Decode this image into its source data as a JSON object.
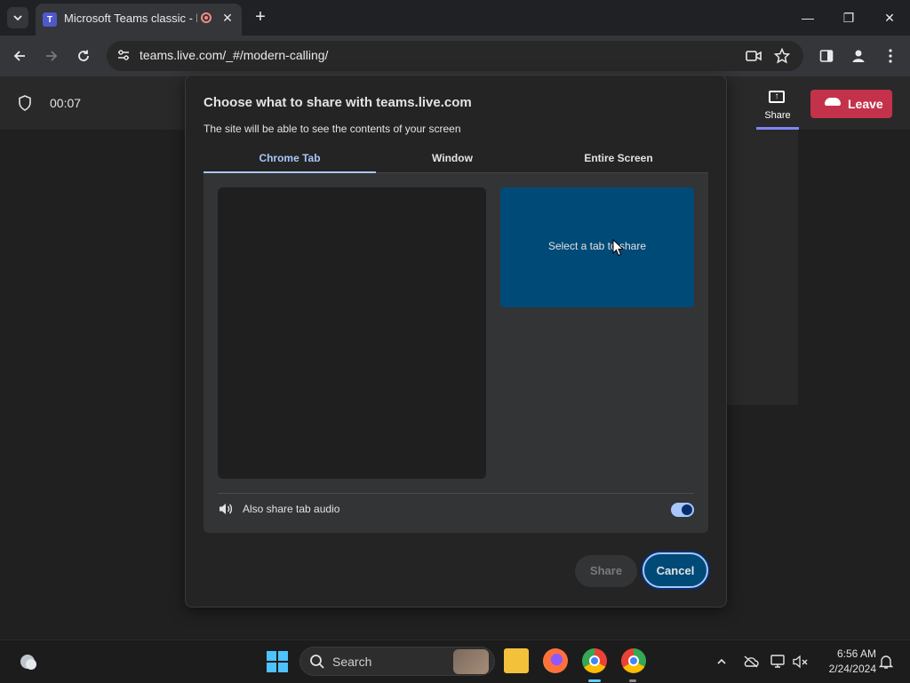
{
  "browser": {
    "tab_title": "Microsoft Teams classic - lo",
    "tab_favicon": "T",
    "new_tab_symbol": "+",
    "close_symbol": "✕",
    "url": "teams.live.com/_#/modern-calling/",
    "window_controls": {
      "minimize": "—",
      "restore": "❐",
      "close": "✕"
    },
    "icons": [
      "tab-search-icon",
      "record-icon",
      "back-icon",
      "forward-icon",
      "reload-icon",
      "site-info-icon",
      "camera-icon",
      "bookmark-star-icon",
      "side-panel-icon",
      "profile-icon",
      "more-icon"
    ]
  },
  "teams": {
    "timer": "00:07",
    "share_label": "Share",
    "leave_label": "Leave"
  },
  "dialog": {
    "title": "Choose what to share with teams.live.com",
    "subtitle": "The site will be able to see the contents of your screen",
    "tabs": [
      {
        "label": "Chrome Tab",
        "selected": true
      },
      {
        "label": "Window",
        "selected": false
      },
      {
        "label": "Entire Screen",
        "selected": false
      }
    ],
    "tab_card_label": "Select a tab to share",
    "audio_label": "Also share tab audio",
    "audio_enabled": true,
    "share_button": "Share",
    "cancel_button": "Cancel"
  },
  "taskbar": {
    "search_label": "Search",
    "time": "6:56 AM",
    "date": "2/24/2024",
    "apps": [
      "file-explorer-icon",
      "firefox-icon",
      "chrome-icon",
      "chrome-canary-icon"
    ]
  },
  "colors": {
    "accent_blue": "#a8c7fa",
    "tab_card": "#004a77",
    "leave_red": "#c4314b",
    "teams_purple": "#7f85f5"
  }
}
